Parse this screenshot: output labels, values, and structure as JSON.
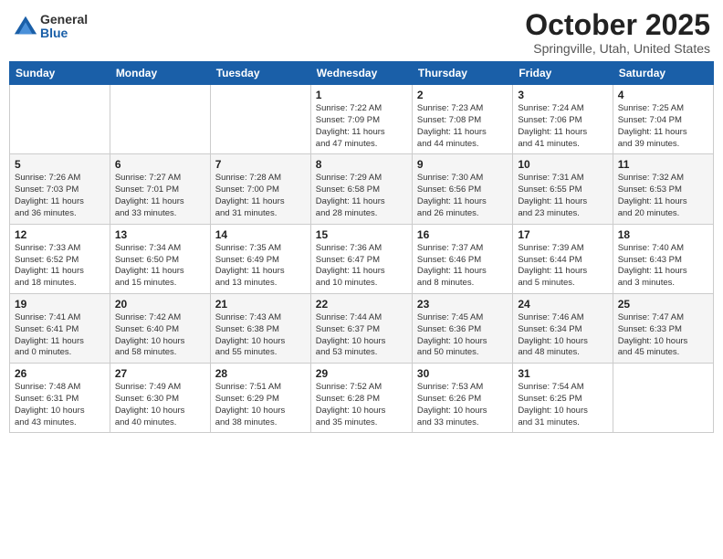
{
  "logo": {
    "general": "General",
    "blue": "Blue"
  },
  "title": "October 2025",
  "subtitle": "Springville, Utah, United States",
  "days_of_week": [
    "Sunday",
    "Monday",
    "Tuesday",
    "Wednesday",
    "Thursday",
    "Friday",
    "Saturday"
  ],
  "weeks": [
    [
      {
        "day": "",
        "info": ""
      },
      {
        "day": "",
        "info": ""
      },
      {
        "day": "",
        "info": ""
      },
      {
        "day": "1",
        "info": "Sunrise: 7:22 AM\nSunset: 7:09 PM\nDaylight: 11 hours\nand 47 minutes."
      },
      {
        "day": "2",
        "info": "Sunrise: 7:23 AM\nSunset: 7:08 PM\nDaylight: 11 hours\nand 44 minutes."
      },
      {
        "day": "3",
        "info": "Sunrise: 7:24 AM\nSunset: 7:06 PM\nDaylight: 11 hours\nand 41 minutes."
      },
      {
        "day": "4",
        "info": "Sunrise: 7:25 AM\nSunset: 7:04 PM\nDaylight: 11 hours\nand 39 minutes."
      }
    ],
    [
      {
        "day": "5",
        "info": "Sunrise: 7:26 AM\nSunset: 7:03 PM\nDaylight: 11 hours\nand 36 minutes."
      },
      {
        "day": "6",
        "info": "Sunrise: 7:27 AM\nSunset: 7:01 PM\nDaylight: 11 hours\nand 33 minutes."
      },
      {
        "day": "7",
        "info": "Sunrise: 7:28 AM\nSunset: 7:00 PM\nDaylight: 11 hours\nand 31 minutes."
      },
      {
        "day": "8",
        "info": "Sunrise: 7:29 AM\nSunset: 6:58 PM\nDaylight: 11 hours\nand 28 minutes."
      },
      {
        "day": "9",
        "info": "Sunrise: 7:30 AM\nSunset: 6:56 PM\nDaylight: 11 hours\nand 26 minutes."
      },
      {
        "day": "10",
        "info": "Sunrise: 7:31 AM\nSunset: 6:55 PM\nDaylight: 11 hours\nand 23 minutes."
      },
      {
        "day": "11",
        "info": "Sunrise: 7:32 AM\nSunset: 6:53 PM\nDaylight: 11 hours\nand 20 minutes."
      }
    ],
    [
      {
        "day": "12",
        "info": "Sunrise: 7:33 AM\nSunset: 6:52 PM\nDaylight: 11 hours\nand 18 minutes."
      },
      {
        "day": "13",
        "info": "Sunrise: 7:34 AM\nSunset: 6:50 PM\nDaylight: 11 hours\nand 15 minutes."
      },
      {
        "day": "14",
        "info": "Sunrise: 7:35 AM\nSunset: 6:49 PM\nDaylight: 11 hours\nand 13 minutes."
      },
      {
        "day": "15",
        "info": "Sunrise: 7:36 AM\nSunset: 6:47 PM\nDaylight: 11 hours\nand 10 minutes."
      },
      {
        "day": "16",
        "info": "Sunrise: 7:37 AM\nSunset: 6:46 PM\nDaylight: 11 hours\nand 8 minutes."
      },
      {
        "day": "17",
        "info": "Sunrise: 7:39 AM\nSunset: 6:44 PM\nDaylight: 11 hours\nand 5 minutes."
      },
      {
        "day": "18",
        "info": "Sunrise: 7:40 AM\nSunset: 6:43 PM\nDaylight: 11 hours\nand 3 minutes."
      }
    ],
    [
      {
        "day": "19",
        "info": "Sunrise: 7:41 AM\nSunset: 6:41 PM\nDaylight: 11 hours\nand 0 minutes."
      },
      {
        "day": "20",
        "info": "Sunrise: 7:42 AM\nSunset: 6:40 PM\nDaylight: 10 hours\nand 58 minutes."
      },
      {
        "day": "21",
        "info": "Sunrise: 7:43 AM\nSunset: 6:38 PM\nDaylight: 10 hours\nand 55 minutes."
      },
      {
        "day": "22",
        "info": "Sunrise: 7:44 AM\nSunset: 6:37 PM\nDaylight: 10 hours\nand 53 minutes."
      },
      {
        "day": "23",
        "info": "Sunrise: 7:45 AM\nSunset: 6:36 PM\nDaylight: 10 hours\nand 50 minutes."
      },
      {
        "day": "24",
        "info": "Sunrise: 7:46 AM\nSunset: 6:34 PM\nDaylight: 10 hours\nand 48 minutes."
      },
      {
        "day": "25",
        "info": "Sunrise: 7:47 AM\nSunset: 6:33 PM\nDaylight: 10 hours\nand 45 minutes."
      }
    ],
    [
      {
        "day": "26",
        "info": "Sunrise: 7:48 AM\nSunset: 6:31 PM\nDaylight: 10 hours\nand 43 minutes."
      },
      {
        "day": "27",
        "info": "Sunrise: 7:49 AM\nSunset: 6:30 PM\nDaylight: 10 hours\nand 40 minutes."
      },
      {
        "day": "28",
        "info": "Sunrise: 7:51 AM\nSunset: 6:29 PM\nDaylight: 10 hours\nand 38 minutes."
      },
      {
        "day": "29",
        "info": "Sunrise: 7:52 AM\nSunset: 6:28 PM\nDaylight: 10 hours\nand 35 minutes."
      },
      {
        "day": "30",
        "info": "Sunrise: 7:53 AM\nSunset: 6:26 PM\nDaylight: 10 hours\nand 33 minutes."
      },
      {
        "day": "31",
        "info": "Sunrise: 7:54 AM\nSunset: 6:25 PM\nDaylight: 10 hours\nand 31 minutes."
      },
      {
        "day": "",
        "info": ""
      }
    ]
  ]
}
